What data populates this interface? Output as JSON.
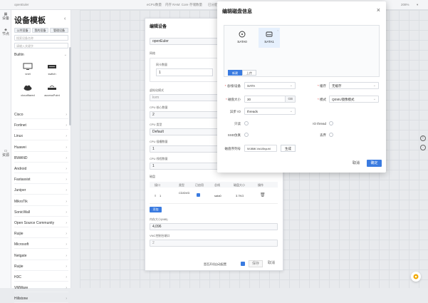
{
  "topbar": {
    "project": "openEuler",
    "info_1": "eCPU数量 ",
    "info_2": "内存 RAM: Core",
    "info_3": "存储数量 ",
    "info_4": "已分配",
    "zoom": "208%"
  },
  "left_rail": {
    "item_1": "设备",
    "item_2": "节点",
    "item_3": "资源"
  },
  "sidebar": {
    "title": "设备模板",
    "btn_1": "公共设备",
    "btn_2": "我的设备",
    "btn_3": "管理设备",
    "search_placeholder": "搜索设备名称",
    "filter_placeholder": "请输入关键字",
    "group_builtin": "Builtin",
    "devices": [
      {
        "label": "vnet"
      },
      {
        "label": "switch"
      },
      {
        "label": "cloudflared"
      },
      {
        "label": "accessPoint"
      }
    ],
    "categories": [
      "Cisco",
      "Fortinet",
      "Linux",
      "Huawei",
      "BWAND",
      "Android",
      "Fastassist",
      "Juniper",
      "MikroTik",
      "SonicWall",
      "Open Source Community",
      "Ruijie",
      "Microsoft",
      "Netgate",
      "Ruijie",
      "H3C",
      "VMWare",
      "Hillstone"
    ]
  },
  "edit_device": {
    "title": "编辑设备",
    "name_value": "openEuler",
    "section_network": "网络",
    "nic_count_label": "网卡数量",
    "nic_count_value": "1",
    "cpu_mode_label": "虚拟化模式",
    "cpu_mode_value": "kvm",
    "cpu_cores_label": "CPU 核心数量",
    "cpu_cores_value": "2",
    "cpu_model_label": "CPU 类型",
    "cpu_model_value": "Default",
    "cpu_sockets_label": "CPU 插槽数量",
    "cpu_sockets_value": "1",
    "cpu_threads_label": "CPU 线程数量",
    "cpu_threads_value": "1",
    "disk_section_label": "磁盘",
    "table_headers": [
      "接口",
      "类型",
      "已启用",
      "总线",
      "磁盘大小",
      "操作"
    ],
    "table_row": {
      "index": "1",
      "type": "CD/DVD",
      "bus": "sata0",
      "size": "3.7KG"
    },
    "add_btn": "添加",
    "memory_label": "内存大小(MiB)",
    "memory_value": "4,096",
    "vnc_label": "VNC控制台端口",
    "vnc_value": "2",
    "auto_start_label": "是否开机自动配置",
    "save_btn": "保存",
    "cancel_btn": "取消"
  },
  "dialog": {
    "title": "编辑磁盘信息",
    "disks": [
      {
        "label": "SATA0"
      },
      {
        "label": "SATA1"
      }
    ],
    "tab_new": "新建",
    "tab_upload": "上传",
    "bus_label": "总线/设备",
    "bus_value": "SATA",
    "cache_label": "缓存",
    "cache_value": "无缓存",
    "size_label": "磁盘大小",
    "size_value": "30",
    "size_unit": "GB",
    "mode_label": "模式",
    "mode_value": "QEMU镜像模式",
    "async_label": "异步 IO",
    "async_value": "threads",
    "readonly_label": "只读",
    "iothread_label": "IO thread",
    "ssd_label": "SSD仿真",
    "discard_label": "丢弃",
    "serial_label": "磁盘序列号",
    "serial_value": "WJ8Ml-VoU0kyuhl",
    "generate_btn": "生成",
    "cancel_btn": "取消",
    "ok_btn": "确定"
  },
  "colors": {
    "primary": "#3a7be0",
    "canvas": "#e8eaed",
    "required": "#e04848"
  }
}
